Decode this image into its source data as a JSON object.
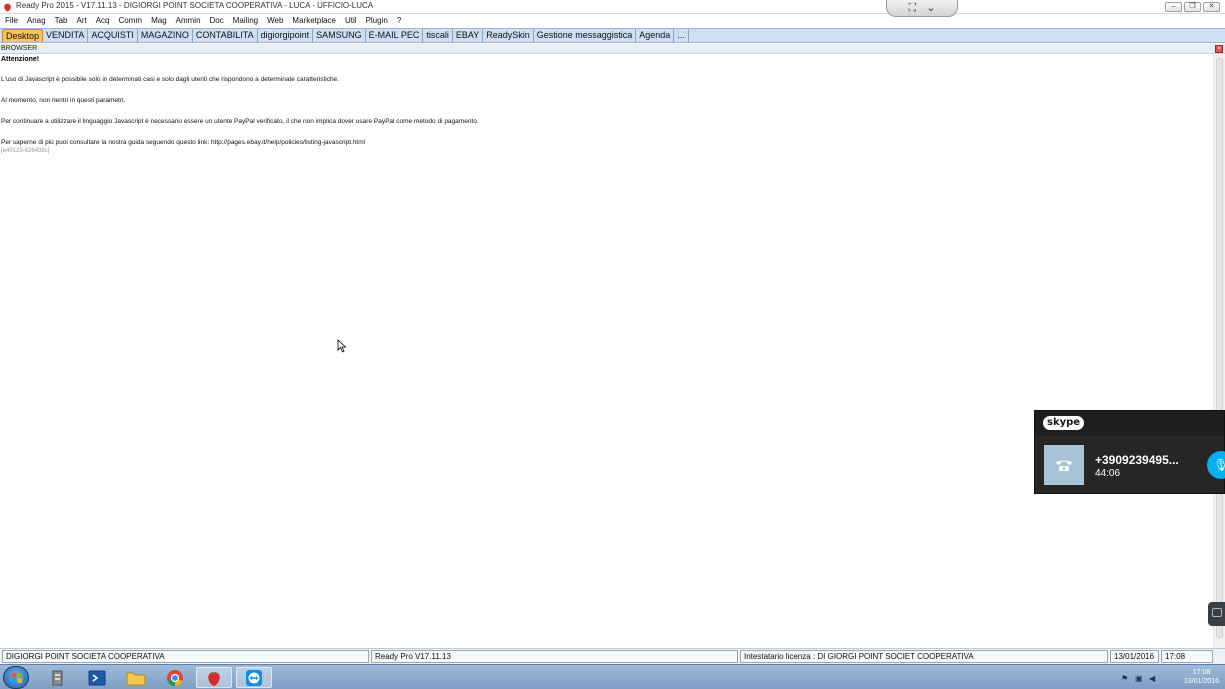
{
  "window": {
    "title": "Ready Pro 2015 - V17.11.13 - DIGIORGI POINT SOCIETA COOPERATIVA - LUCA - UFFICIO-LUCA",
    "min_glyph": "–",
    "restore_glyph": "❐",
    "close_glyph": "✕"
  },
  "remote": {
    "expand_glyph": "⛶",
    "chevron_glyph": "⌄"
  },
  "menu": [
    "File",
    "Anag",
    "Tab",
    "Art",
    "Acq",
    "Comm",
    "Mag",
    "Ammin",
    "Doc",
    "Mailing",
    "Web",
    "Marketplace",
    "Util",
    "Plugin",
    "?"
  ],
  "tabs": [
    "Desktop",
    "VENDITA",
    "ACQUISTI",
    "MAGAZINO",
    "CONTABILITA",
    "digiorgipoint",
    "SAMSUNG",
    "E-MAIL PEC",
    "tiscali",
    "EBAY",
    "ReadySkin",
    "Gestione messaggistica",
    "Agenda",
    "..."
  ],
  "active_tab": "Desktop",
  "panel": {
    "label": "BROWSER",
    "close_glyph": "×"
  },
  "content": {
    "title": "Attenzione!",
    "paragraphs": [
      "L'uso di Javascript è possibile solo in determinati casi e solo dagli utenti che rispondono a determinate caratteristiche.",
      "Al momento, non rientri in questi parametri.",
      "Per continuare a utilizzare il linguaggio Javascript è necessario essere un utente PayPal verificato, il che non implica dover usare PayPal come metodo di pagamento.",
      "Per saperne di più puoi consultare la nostra guida seguendo questo link: http://pages.ebay.it/help/policies/listing-javascript.html"
    ],
    "code": "[e40123-626439c]"
  },
  "skype": {
    "logo": "skype",
    "number": "+3909239495...",
    "duration": "44:06",
    "mic_glyph": "🎙"
  },
  "status": {
    "company": "DIGIORGI POINT SOCIETA COOPERATIVA",
    "version": "Ready Pro V17.11.13",
    "license": "Intestatario licenza : DI GIORGI POINT SOCIET COOPERATIVA",
    "date": "13/01/2016",
    "time": "17:08"
  },
  "taskbar": {
    "clock_time": "17:08",
    "clock_date": "13/01/2016"
  },
  "colors": {
    "tab_bar": "#cfdff2",
    "active_tab": "#f6c35c",
    "skype_bg": "#262626",
    "skype_accent": "#00aff0",
    "taskbar": "#8fadcf"
  }
}
